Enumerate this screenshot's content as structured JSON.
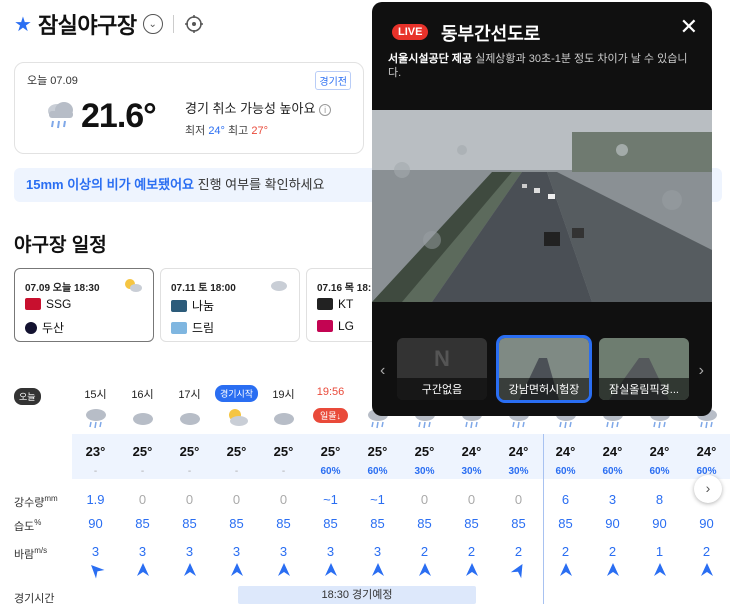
{
  "header": {
    "title": "잠실야구장"
  },
  "current": {
    "date": "오늘 07.09",
    "badge": "경기전",
    "temp": "21.6°",
    "note": "경기 취소 가능성 높아요",
    "min_label": "최저",
    "min": "24°",
    "max_label": "최고",
    "max": "27°"
  },
  "notice": {
    "highlight": "15mm 이상의 비가 예보됐어요",
    "rest": " 진행 여부를 확인하세요"
  },
  "schedule": {
    "title": "야구장 일정",
    "games": [
      {
        "date": "07.09 오늘 18:30",
        "home": "SSG",
        "away": "두산"
      },
      {
        "date": "07.11 토 18:00",
        "home": "나눔",
        "away": "드림"
      },
      {
        "date": "07.16 목 18:",
        "home": "KT",
        "away": "LG"
      }
    ]
  },
  "hourly": {
    "today": "오늘",
    "labels": {
      "rain": "강수량",
      "rain_unit": "mm",
      "humidity": "습도",
      "humidity_unit": "%",
      "wind": "바람",
      "wind_unit": "m/s",
      "game_time": "경기시간"
    },
    "game_bar": "18:30 경기예정",
    "hours": [
      {
        "h": "15시",
        "t": "23°",
        "p": "-",
        "rain": "1.9",
        "hum": "90",
        "wind": "3"
      },
      {
        "h": "16시",
        "t": "25°",
        "p": "-",
        "rain": "0",
        "hum": "85",
        "wind": "3"
      },
      {
        "h": "17시",
        "t": "25°",
        "p": "-",
        "rain": "0",
        "hum": "85",
        "wind": "3"
      },
      {
        "h": "경기시작",
        "t": "25°",
        "p": "-",
        "rain": "0",
        "hum": "85",
        "wind": "3"
      },
      {
        "h": "19시",
        "t": "25°",
        "p": "-",
        "rain": "0",
        "hum": "85",
        "wind": "3"
      },
      {
        "h": "19:56",
        "sunset": "일몰↓",
        "t": "25°",
        "p": "60%",
        "rain": "~1",
        "hum": "85",
        "wind": "3"
      },
      {
        "h": "",
        "t": "25°",
        "p": "60%",
        "rain": "~1",
        "hum": "85",
        "wind": "3"
      },
      {
        "h": "",
        "t": "25°",
        "p": "30%",
        "rain": "0",
        "hum": "85",
        "wind": "2"
      },
      {
        "h": "",
        "t": "24°",
        "p": "30%",
        "rain": "0",
        "hum": "85",
        "wind": "2"
      },
      {
        "h": "",
        "t": "24°",
        "p": "30%",
        "rain": "0",
        "hum": "85",
        "wind": "2"
      },
      {
        "h": "",
        "t": "24°",
        "p": "60%",
        "rain": "6",
        "hum": "85",
        "wind": "2"
      },
      {
        "h": "",
        "t": "24°",
        "p": "60%",
        "rain": "3",
        "hum": "90",
        "wind": "2"
      },
      {
        "h": "",
        "t": "24°",
        "p": "60%",
        "rain": "8",
        "hum": "90",
        "wind": "1"
      },
      {
        "h": "",
        "t": "24°",
        "p": "60%",
        "rain": "",
        "hum": "90",
        "wind": "2"
      }
    ]
  },
  "popup": {
    "live": "LIVE",
    "road": "동부간선도로",
    "source": "서울시설공단 제공",
    "desc": " 실제상황과 30초-1분 정도 차이가 날 수 있습니다.",
    "thumbs": [
      "구간없음",
      "강남면허시험장",
      "잠실올림픽경..."
    ],
    "none_mark": "N"
  }
}
